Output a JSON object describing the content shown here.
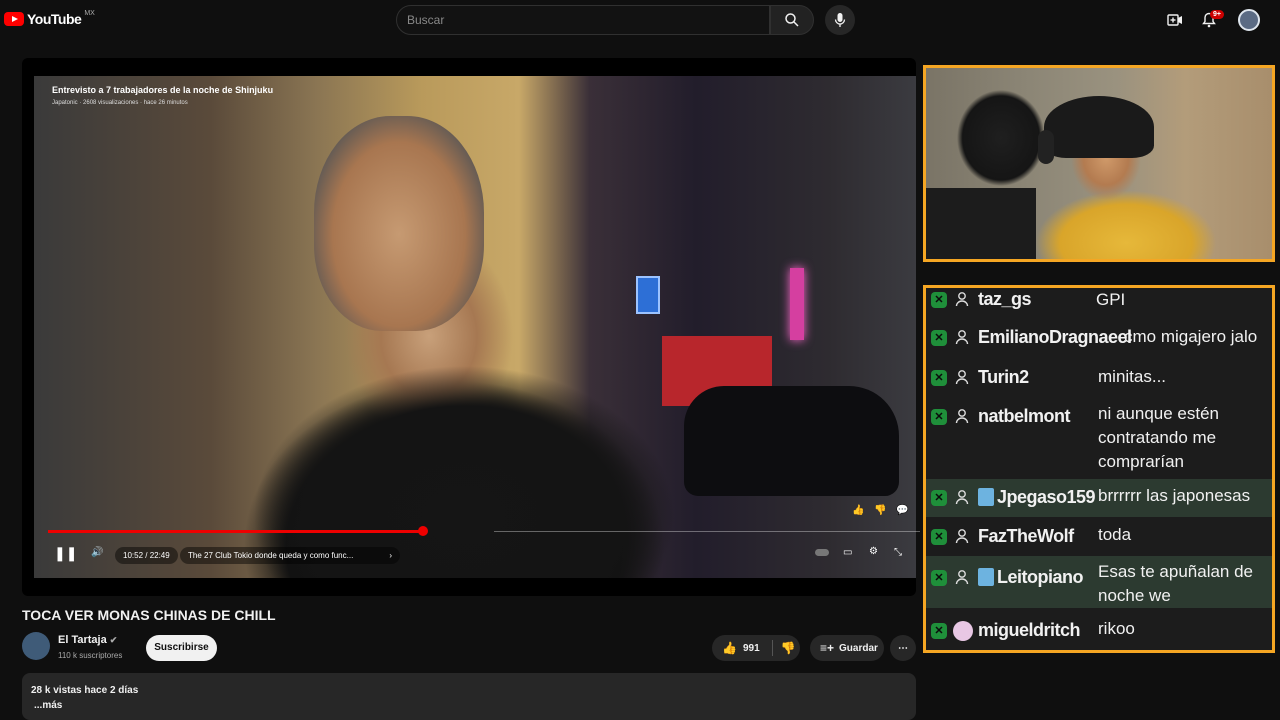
{
  "header": {
    "logo_text": "YouTube",
    "country": "MX",
    "search_placeholder": "Buscar",
    "notifications_badge": "9+"
  },
  "player": {
    "embedded_title": "Entrevisto a 7 trabajadores de la noche de Shinjuku",
    "embedded_meta": "Japatonic · 2608 visualizaciones · hace 26 minutos",
    "time": "10:52 / 22:49",
    "chapter": "The 27 Club Tokio donde queda y como func...",
    "progress": 0.475
  },
  "video": {
    "title": "TOCA VER MONAS CHINAS DE CHILL",
    "channel": "El Tartaja",
    "subscribers": "110 k suscriptores",
    "subscribe_label": "Suscribirse",
    "likes": "991",
    "save_label": "Guardar",
    "views_date": "28 k vistas  hace 2 días",
    "more_label": "...más"
  },
  "chat": {
    "messages": [
      {
        "user": "taz_gs",
        "text": "GPI"
      },
      {
        "user": "EmilianoDragnaeel",
        "text": "cmo migajero jalo"
      },
      {
        "user": "Turin2",
        "text": "minitas..."
      },
      {
        "user": "natbelmont",
        "text": "ni aunque estén contratando me comprarían"
      },
      {
        "user": "Jpegaso159",
        "text": "brrrrrr las japonesas"
      },
      {
        "user": "FazTheWolf",
        "text": "toda"
      },
      {
        "user": "Leitopiano",
        "text": "Esas te apuñalan de noche we"
      },
      {
        "user": "migueldritch",
        "text": "rikoo"
      }
    ]
  },
  "colors": {
    "accent": "#ff0000",
    "frame": "#f5a623",
    "badge_green": "#1f8f3a"
  }
}
